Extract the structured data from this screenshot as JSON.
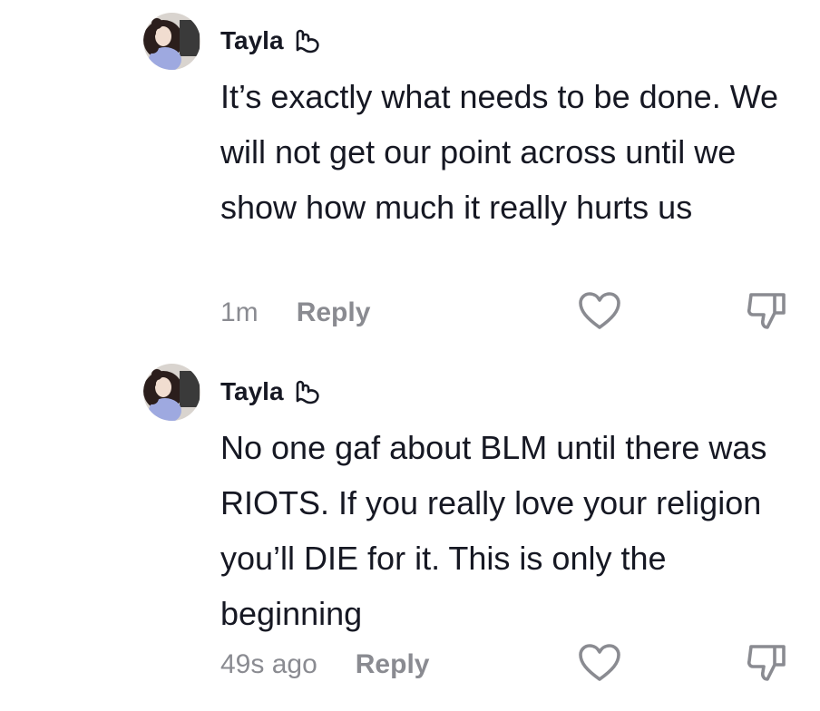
{
  "comments": [
    {
      "author": "Tayla",
      "badge_icon": "hand-gesture-icon",
      "text": "It’s exactly what needs to be done. We will not get our point across until we show how much it really hurts us",
      "time": "1m",
      "reply_label": "Reply"
    },
    {
      "author": "Tayla",
      "badge_icon": "hand-gesture-icon",
      "text": "No one gaf about BLM until there was RIOTS. If you really love your religion you’ll DIE for it. This is only the beginning",
      "time": "49s ago",
      "reply_label": "Reply"
    }
  ],
  "icons": {
    "like": "heart-outline-icon",
    "dislike": "thumbs-down-outline-icon"
  },
  "colors": {
    "text": "#161823",
    "secondary": "#8a8b91",
    "icon_stroke": "#8a8b91"
  }
}
